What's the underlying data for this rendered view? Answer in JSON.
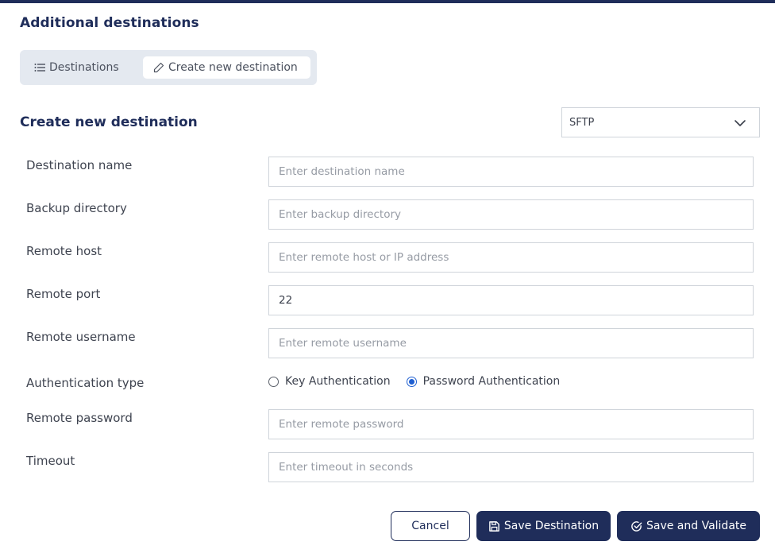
{
  "header": {
    "title": "Additional destinations"
  },
  "tabs": [
    {
      "label": "Destinations",
      "icon": "list-icon"
    },
    {
      "label": "Create new destination",
      "icon": "pencil-icon",
      "active": true
    }
  ],
  "form": {
    "title": "Create new destination",
    "protocol": {
      "selected": "SFTP",
      "icon": "chevron-down-icon"
    },
    "fields": {
      "destination_name": {
        "label": "Destination name",
        "placeholder": "Enter destination name",
        "value": ""
      },
      "backup_directory": {
        "label": "Backup directory",
        "placeholder": "Enter backup directory",
        "value": ""
      },
      "remote_host": {
        "label": "Remote host",
        "placeholder": "Enter remote host or IP address",
        "value": ""
      },
      "remote_port": {
        "label": "Remote port",
        "placeholder": "",
        "value": "22"
      },
      "remote_username": {
        "label": "Remote username",
        "placeholder": "Enter remote username",
        "value": ""
      },
      "remote_password": {
        "label": "Remote password",
        "placeholder": "Enter remote password",
        "value": ""
      },
      "timeout": {
        "label": "Timeout",
        "placeholder": "Enter timeout in seconds",
        "value": ""
      }
    },
    "auth": {
      "label": "Authentication type",
      "options": [
        "Key Authentication",
        "Password Authentication"
      ],
      "selected": "Password Authentication"
    }
  },
  "buttons": {
    "cancel": "Cancel",
    "save": "Save Destination",
    "save_validate": "Save and Validate"
  },
  "colors": {
    "brand": "#1f2d5a",
    "radio_accent": "#1f5fd1",
    "tab_bg": "#e4e9f0"
  }
}
